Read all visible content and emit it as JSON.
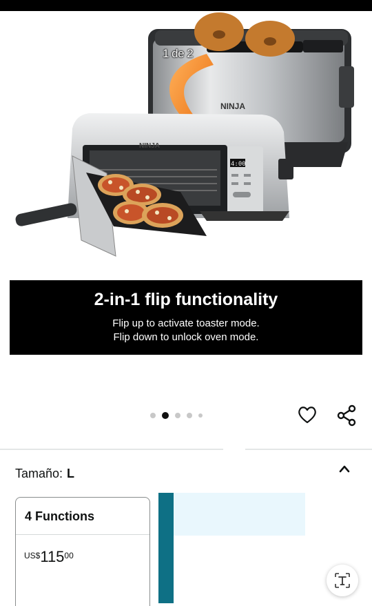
{
  "gallery": {
    "counter": "1 de 2",
    "caption_title": "2-in-1 flip functionality",
    "caption_line1": "Flip up to activate toaster mode.",
    "caption_line2": "Flip down to unlock oven mode.",
    "brand_top": "NINJA",
    "brand_front": "NINJA",
    "display_time": "4:00",
    "active_index": 2,
    "dot_count": 5
  },
  "icons": {
    "heart": "heart-icon",
    "share": "share-icon",
    "chevron": "chevron-up-icon",
    "text_button": "text-recognition-icon"
  },
  "variant": {
    "label": "Tamaño:",
    "value": "L"
  },
  "option": {
    "name": "4 Functions",
    "currency": "US$",
    "price_whole": "115",
    "price_fraction": "00"
  },
  "colors": {
    "swatch_dark": "#0e7085",
    "swatch_light": "#e9f7fd",
    "arrow": "#f07a1a"
  }
}
